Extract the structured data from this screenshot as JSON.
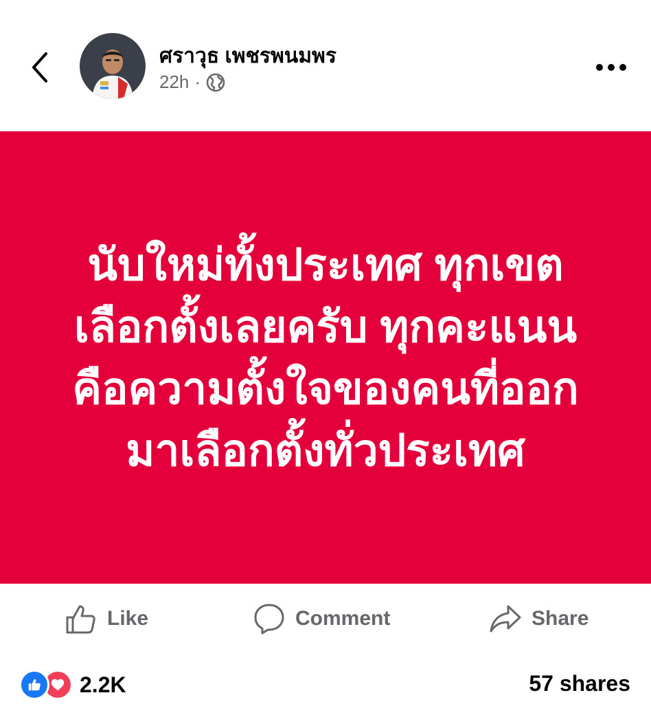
{
  "post": {
    "author_name": "ศราวุธ เพชรพนมพร",
    "time": "22h",
    "separator": "·",
    "audience_icon": "globe-icon",
    "image_text": "นับใหม่ทั้งประเทศ ทุกเขต\nเลือกตั้งเลยครับ ทุกคะแนน\nคือความตั้งใจของคนที่ออก\nมาเลือกตั้งทั่วประเทศ",
    "image_background": "#e4003a"
  },
  "actions": {
    "like_label": "Like",
    "comment_label": "Comment",
    "share_label": "Share"
  },
  "stats": {
    "reactions_count": "2.2K",
    "shares": "57 shares"
  },
  "icons": {
    "back": "chevron-left-icon",
    "more": "more-horizontal-icon",
    "like": "thumbs-up-icon",
    "comment": "comment-bubble-icon",
    "share": "share-arrow-icon"
  },
  "colors": {
    "like_blue": "#1877f2",
    "love_red": "#f33e58",
    "secondary_text": "#65676b"
  }
}
